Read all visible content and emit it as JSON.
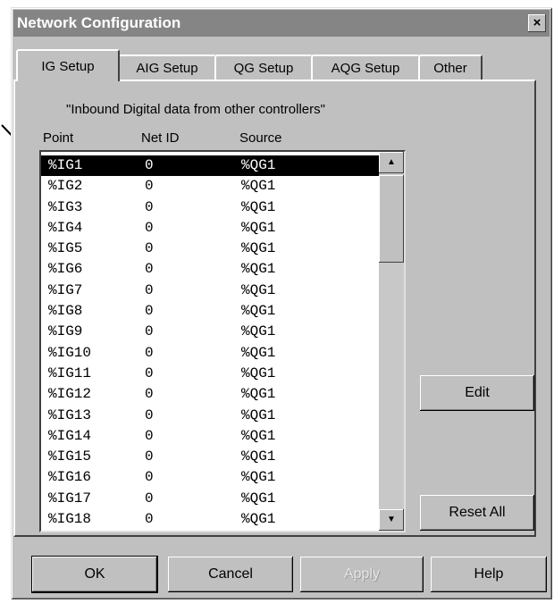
{
  "window": {
    "title": "Network Configuration",
    "close_glyph": "×"
  },
  "tabs": [
    {
      "label": "IG Setup",
      "active": true
    },
    {
      "label": "AIG Setup",
      "active": false
    },
    {
      "label": "QG Setup",
      "active": false
    },
    {
      "label": "AQG Setup",
      "active": false
    },
    {
      "label": "Other",
      "active": false
    }
  ],
  "caption": "\"Inbound Digital data from other controllers\"",
  "columns": {
    "point": "Point",
    "net_id": "Net ID",
    "source": "Source"
  },
  "rows": [
    {
      "point": "%IG1",
      "net_id": "0",
      "source": "%QG1"
    },
    {
      "point": "%IG2",
      "net_id": "0",
      "source": "%QG1"
    },
    {
      "point": "%IG3",
      "net_id": "0",
      "source": "%QG1"
    },
    {
      "point": "%IG4",
      "net_id": "0",
      "source": "%QG1"
    },
    {
      "point": "%IG5",
      "net_id": "0",
      "source": "%QG1"
    },
    {
      "point": "%IG6",
      "net_id": "0",
      "source": "%QG1"
    },
    {
      "point": "%IG7",
      "net_id": "0",
      "source": "%QG1"
    },
    {
      "point": "%IG8",
      "net_id": "0",
      "source": "%QG1"
    },
    {
      "point": "%IG9",
      "net_id": "0",
      "source": "%QG1"
    },
    {
      "point": "%IG10",
      "net_id": "0",
      "source": "%QG1"
    },
    {
      "point": "%IG11",
      "net_id": "0",
      "source": "%QG1"
    },
    {
      "point": "%IG12",
      "net_id": "0",
      "source": "%QG1"
    },
    {
      "point": "%IG13",
      "net_id": "0",
      "source": "%QG1"
    },
    {
      "point": "%IG14",
      "net_id": "0",
      "source": "%QG1"
    },
    {
      "point": "%IG15",
      "net_id": "0",
      "source": "%QG1"
    },
    {
      "point": "%IG16",
      "net_id": "0",
      "source": "%QG1"
    },
    {
      "point": "%IG17",
      "net_id": "0",
      "source": "%QG1"
    },
    {
      "point": "%IG18",
      "net_id": "0",
      "source": "%QG1"
    }
  ],
  "selected_row": 0,
  "side_buttons": {
    "edit": "Edit",
    "reset_all": "Reset All"
  },
  "footer_buttons": {
    "ok": "OK",
    "cancel": "Cancel",
    "apply": "Apply",
    "help": "Help"
  }
}
